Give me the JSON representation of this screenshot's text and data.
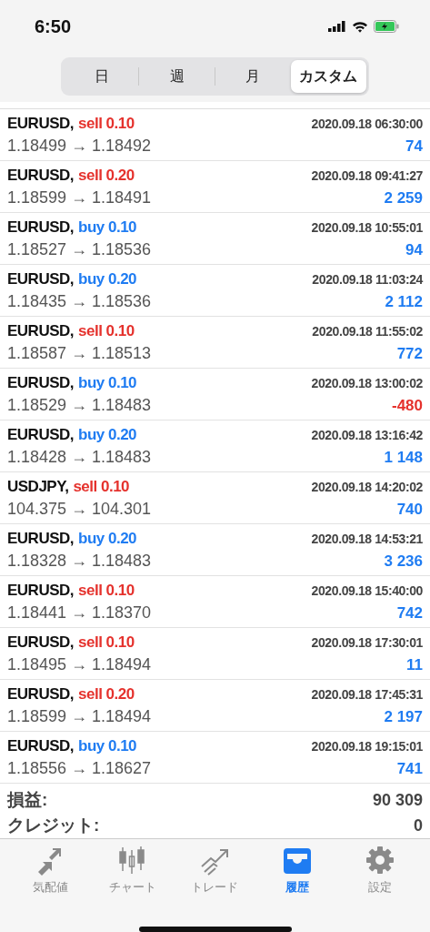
{
  "status_bar": {
    "time": "6:50"
  },
  "period_tabs": [
    {
      "label": "日",
      "selected": false
    },
    {
      "label": "週",
      "selected": false
    },
    {
      "label": "月",
      "selected": false
    },
    {
      "label": "カスタム",
      "selected": true
    }
  ],
  "trades": [
    {
      "symbol": "EURUSD,",
      "action": "sell 0.10",
      "kind": "sell",
      "time": "2020.09.18 06:30:00",
      "prices": "1.18499 → 1.18492",
      "profit": "74",
      "loss": false
    },
    {
      "symbol": "EURUSD,",
      "action": "sell 0.20",
      "kind": "sell",
      "time": "2020.09.18 09:41:27",
      "prices": "1.18599 → 1.18491",
      "profit": "2 259",
      "loss": false
    },
    {
      "symbol": "EURUSD,",
      "action": "buy 0.10",
      "kind": "buy",
      "time": "2020.09.18 10:55:01",
      "prices": "1.18527 → 1.18536",
      "profit": "94",
      "loss": false
    },
    {
      "symbol": "EURUSD,",
      "action": "buy 0.20",
      "kind": "buy",
      "time": "2020.09.18 11:03:24",
      "prices": "1.18435 → 1.18536",
      "profit": "2 112",
      "loss": false
    },
    {
      "symbol": "EURUSD,",
      "action": "sell 0.10",
      "kind": "sell",
      "time": "2020.09.18 11:55:02",
      "prices": "1.18587 → 1.18513",
      "profit": "772",
      "loss": false
    },
    {
      "symbol": "EURUSD,",
      "action": "buy 0.10",
      "kind": "buy",
      "time": "2020.09.18 13:00:02",
      "prices": "1.18529 → 1.18483",
      "profit": "-480",
      "loss": true
    },
    {
      "symbol": "EURUSD,",
      "action": "buy 0.20",
      "kind": "buy",
      "time": "2020.09.18 13:16:42",
      "prices": "1.18428 → 1.18483",
      "profit": "1 148",
      "loss": false
    },
    {
      "symbol": "USDJPY,",
      "action": "sell 0.10",
      "kind": "sell",
      "time": "2020.09.18 14:20:02",
      "prices": "104.375 → 104.301",
      "profit": "740",
      "loss": false
    },
    {
      "symbol": "EURUSD,",
      "action": "buy 0.20",
      "kind": "buy",
      "time": "2020.09.18 14:53:21",
      "prices": "1.18328 → 1.18483",
      "profit": "3 236",
      "loss": false
    },
    {
      "symbol": "EURUSD,",
      "action": "sell 0.10",
      "kind": "sell",
      "time": "2020.09.18 15:40:00",
      "prices": "1.18441 → 1.18370",
      "profit": "742",
      "loss": false
    },
    {
      "symbol": "EURUSD,",
      "action": "sell 0.10",
      "kind": "sell",
      "time": "2020.09.18 17:30:01",
      "prices": "1.18495 → 1.18494",
      "profit": "11",
      "loss": false
    },
    {
      "symbol": "EURUSD,",
      "action": "sell 0.20",
      "kind": "sell",
      "time": "2020.09.18 17:45:31",
      "prices": "1.18599 → 1.18494",
      "profit": "2 197",
      "loss": false
    },
    {
      "symbol": "EURUSD,",
      "action": "buy 0.10",
      "kind": "buy",
      "time": "2020.09.18 19:15:01",
      "prices": "1.18556 → 1.18627",
      "profit": "741",
      "loss": false
    }
  ],
  "totals": [
    {
      "label": "損益:",
      "value": "90 309"
    },
    {
      "label": "クレジット:",
      "value": "0"
    }
  ],
  "tab_bar": [
    {
      "label": "気配値",
      "selected": false
    },
    {
      "label": "チャート",
      "selected": false
    },
    {
      "label": "トレード",
      "selected": false
    },
    {
      "label": "履歴",
      "selected": true
    },
    {
      "label": "設定",
      "selected": false
    }
  ]
}
